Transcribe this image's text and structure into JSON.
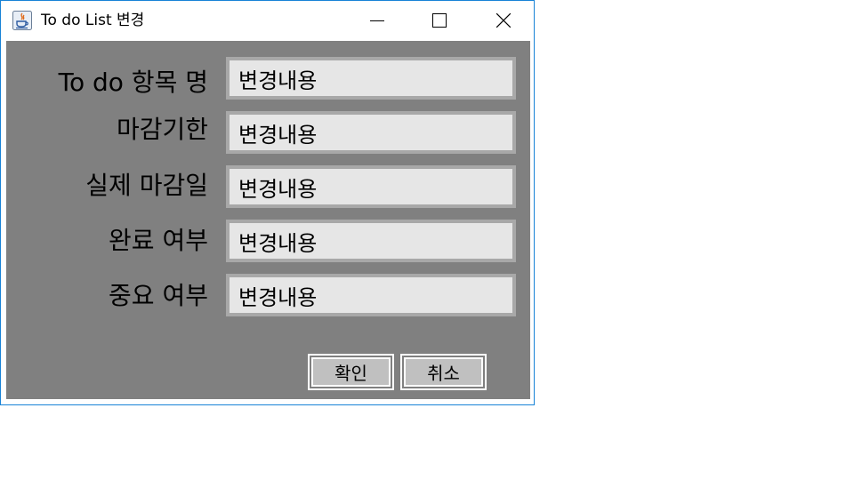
{
  "window": {
    "title": "To do List 변경",
    "controls": {
      "minimize": "minimize-icon",
      "maximize": "maximize-icon",
      "close": "close-icon"
    },
    "app_icon": "java-icon"
  },
  "form": {
    "rows": [
      {
        "label": "To do 항목 명",
        "value": "변경내용"
      },
      {
        "label": "마감기한",
        "value": "변경내용"
      },
      {
        "label": "실제 마감일",
        "value": "변경내용"
      },
      {
        "label": "완료 여부",
        "value": "변경내용"
      },
      {
        "label": "중요 여부",
        "value": "변경내용"
      }
    ]
  },
  "buttons": {
    "ok_label": "확인",
    "cancel_label": "취소"
  },
  "colors": {
    "panel_bg": "#808080",
    "field_bg": "#e6e6e6",
    "field_border": "#a8a8a8",
    "window_border": "#1883d7"
  }
}
